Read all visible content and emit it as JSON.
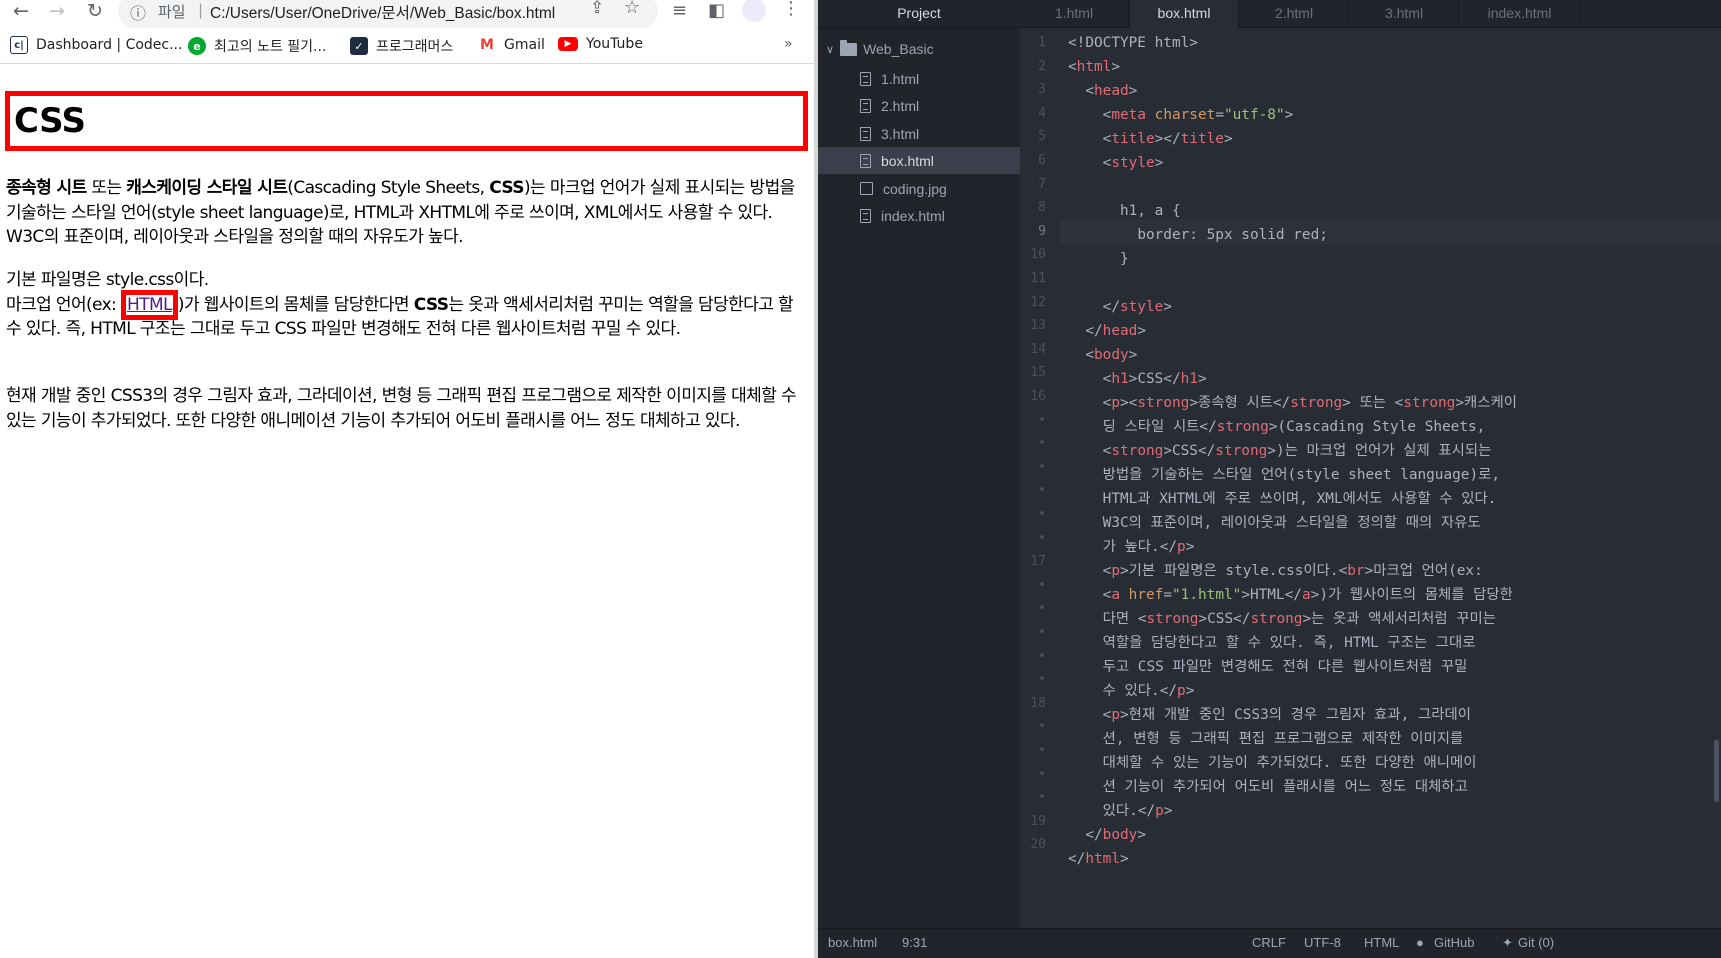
{
  "browser": {
    "omnibox": {
      "scheme": "파일",
      "url": "C:/Users/User/OneDrive/문서/Web_Basic/box.html"
    },
    "bookmarks": [
      {
        "label": "Dashboard | Codec...",
        "icon": "codecademy-icon"
      },
      {
        "label": "최고의 노트 필기...",
        "icon": "evernote-icon"
      },
      {
        "label": "프로그래머스",
        "icon": "programmers-icon"
      },
      {
        "label": "Gmail",
        "icon": "gmail-icon"
      },
      {
        "label": "YouTube",
        "icon": "youtube-icon"
      }
    ],
    "bookmarks_more": "»",
    "page": {
      "h1": "CSS",
      "p1": {
        "s1": "종속형 시트",
        "t1": " 또는 ",
        "s2": "캐스케이딩 스타일 시트",
        "t2": "(Cascading Style Sheets, ",
        "s3": "CSS",
        "t3": ")는 마크업 언어가 실제 표시되는 방법을 기술하는 스타일 언어(style sheet language)로, HTML과 XHTML에 주로 쓰이며, XML에서도 사용할 수 있다. W3C의 표준이며, 레이아웃과 스타일을 정의할 때의 자유도가 높다."
      },
      "p2": {
        "t1": "기본 파일명은 style.css이다.",
        "t2": "마크업 언어(ex: ",
        "link": "HTML",
        "t3": ")가 웹사이트의 몸체를 담당한다면 ",
        "s1": "CSS",
        "t4": "는 옷과 액세서리처럼 꾸미는 역할을 담당한다고 할 수 있다. 즉, HTML 구조는 그대로 두고 CSS 파일만 변경해도 전혀 다른 웹사이트처럼 꾸밀 수 있다."
      },
      "p3": "현재 개발 중인 CSS3의 경우 그림자 효과, 그라데이션, 변형 등 그래픽 편집 프로그램으로 제작한 이미지를 대체할 수 있는 기능이 추가되었다. 또한 다양한 애니메이션 기능이 추가되어 어도비 플래시를 어느 정도 대체하고 있다."
    }
  },
  "editor": {
    "tree_title": "Project",
    "root_folder": "Web_Basic",
    "files": [
      {
        "name": "1.html",
        "active": false
      },
      {
        "name": "2.html",
        "active": false
      },
      {
        "name": "3.html",
        "active": false
      },
      {
        "name": "box.html",
        "active": true
      },
      {
        "name": "coding.jpg",
        "active": false
      },
      {
        "name": "index.html",
        "active": false
      }
    ],
    "tabs": [
      "1.html",
      "box.html",
      "2.html",
      "3.html",
      "index.html"
    ],
    "active_tab": "box.html",
    "gutter": [
      "1",
      "2",
      "3",
      "4",
      "5",
      "6",
      "7",
      "8",
      "9",
      "10",
      "11",
      "12",
      "13",
      "14",
      "15",
      "16",
      "•",
      "•",
      "•",
      "•",
      "•",
      "•",
      "17",
      "•",
      "•",
      "•",
      "•",
      "•",
      "18",
      "•",
      "•",
      "•",
      "•",
      "19",
      "20"
    ],
    "code": {
      "l1": "<!DOCTYPE html>",
      "l8": "h1, a {",
      "l9": "border: 5px solid red;",
      "l10": "}",
      "l16_text1": "종속형 시트",
      "l16_text2": " 또는 ",
      "l16_text3": "캐스케이",
      "w1": "딩 스타일 시트",
      "w1b": "(Cascading Style Sheets,",
      "w2b": ")는 마크업 언어가 실제 표시되는",
      "w3": "방법을 기술하는 스타일 언어(style sheet language)로,",
      "w4": "HTML과 XHTML에 주로 쓰이며, XML에서도 사용할 수 있다.",
      "w5": "W3C의 표준이며, 레이아웃과 스타일을 정의할 때의 자유도",
      "w6": "가 높다.",
      "l17a": "기본 파일명은 style.css이다.",
      "l17b": "마크업 언어(ex:",
      "w7_attr": "href",
      "w7_val": "\"1.html\"",
      "w7_text": "HTML",
      "w7_tail": ")가 웹사이트의 몸체를 담당한",
      "w8a": "다면 ",
      "w8b": "CSS",
      "w8c": "는 옷과 액세서리처럼 꾸미는",
      "w9": "역할을 담당한다고 할 수 있다. 즉, HTML 구조는 그대로",
      "w10": "두고 CSS 파일만 변경해도 전혀 다른 웹사이트처럼 꾸밀",
      "w11": "수 있다.",
      "l18a": "현재 개발 중인 CSS3의 경우 그림자 효과, 그라데이",
      "w12": "션, 변형 등 그래픽 편집 프로그램으로 제작한 이미지를",
      "w13": "대체할 수 있는 기능이 추가되었다. 또한 다양한 애니메이",
      "w14": "션 기능이 추가되어 어도비 플래시를 어느 정도 대체하고",
      "w15": "있다."
    },
    "status": {
      "file": "box.html",
      "cursor": "9:31",
      "line_ending": "CRLF",
      "encoding": "UTF-8",
      "grammar": "HTML",
      "github": "GitHub",
      "git": "Git (0)"
    }
  }
}
